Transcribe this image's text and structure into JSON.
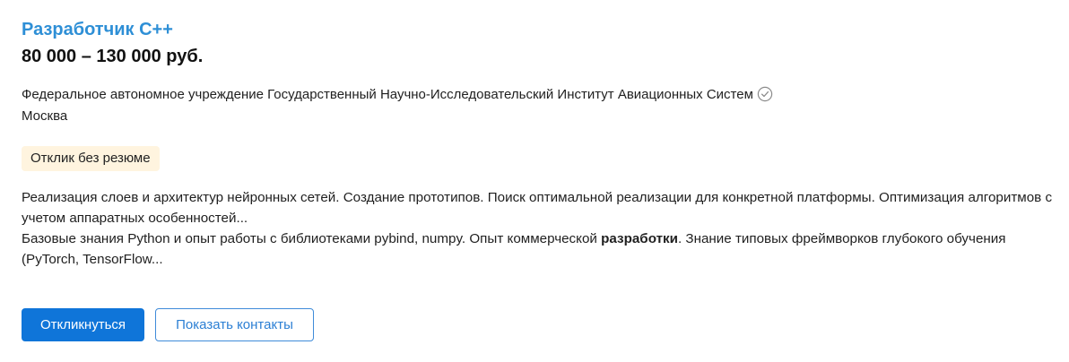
{
  "vacancy": {
    "title": "Разработчик С++",
    "salary": "80 000 – 130 000 руб.",
    "employer": "Федеральное автономное учреждение Государственный Научно-Исследовательский Институт Авиационных Систем",
    "city": "Москва",
    "badge": "Отклик без резюме",
    "description": {
      "line1": "Реализация слоев и архитектур нейронных сетей. Создание прототипов. Поиск оптимальной реализации для конкретной платформы. Оптимизация алгоритмов с учетом аппаратных особенностей...",
      "line2_before": "Базовые знания Python и опыт работы с библиотеками pybind, numpy. Опыт коммерческой ",
      "line2_bold": "разработки",
      "line2_after": ". Знание типовых фреймворков глубокого обучения (PyTorch, TensorFlow..."
    }
  },
  "actions": {
    "respond_label": "Откликнуться",
    "show_contacts_label": "Показать контакты"
  },
  "icons": {
    "verified": "check-circle-icon"
  },
  "colors": {
    "title": "#2e8fd6",
    "primary_button": "#0f75d9",
    "badge_background": "#fff4df"
  }
}
